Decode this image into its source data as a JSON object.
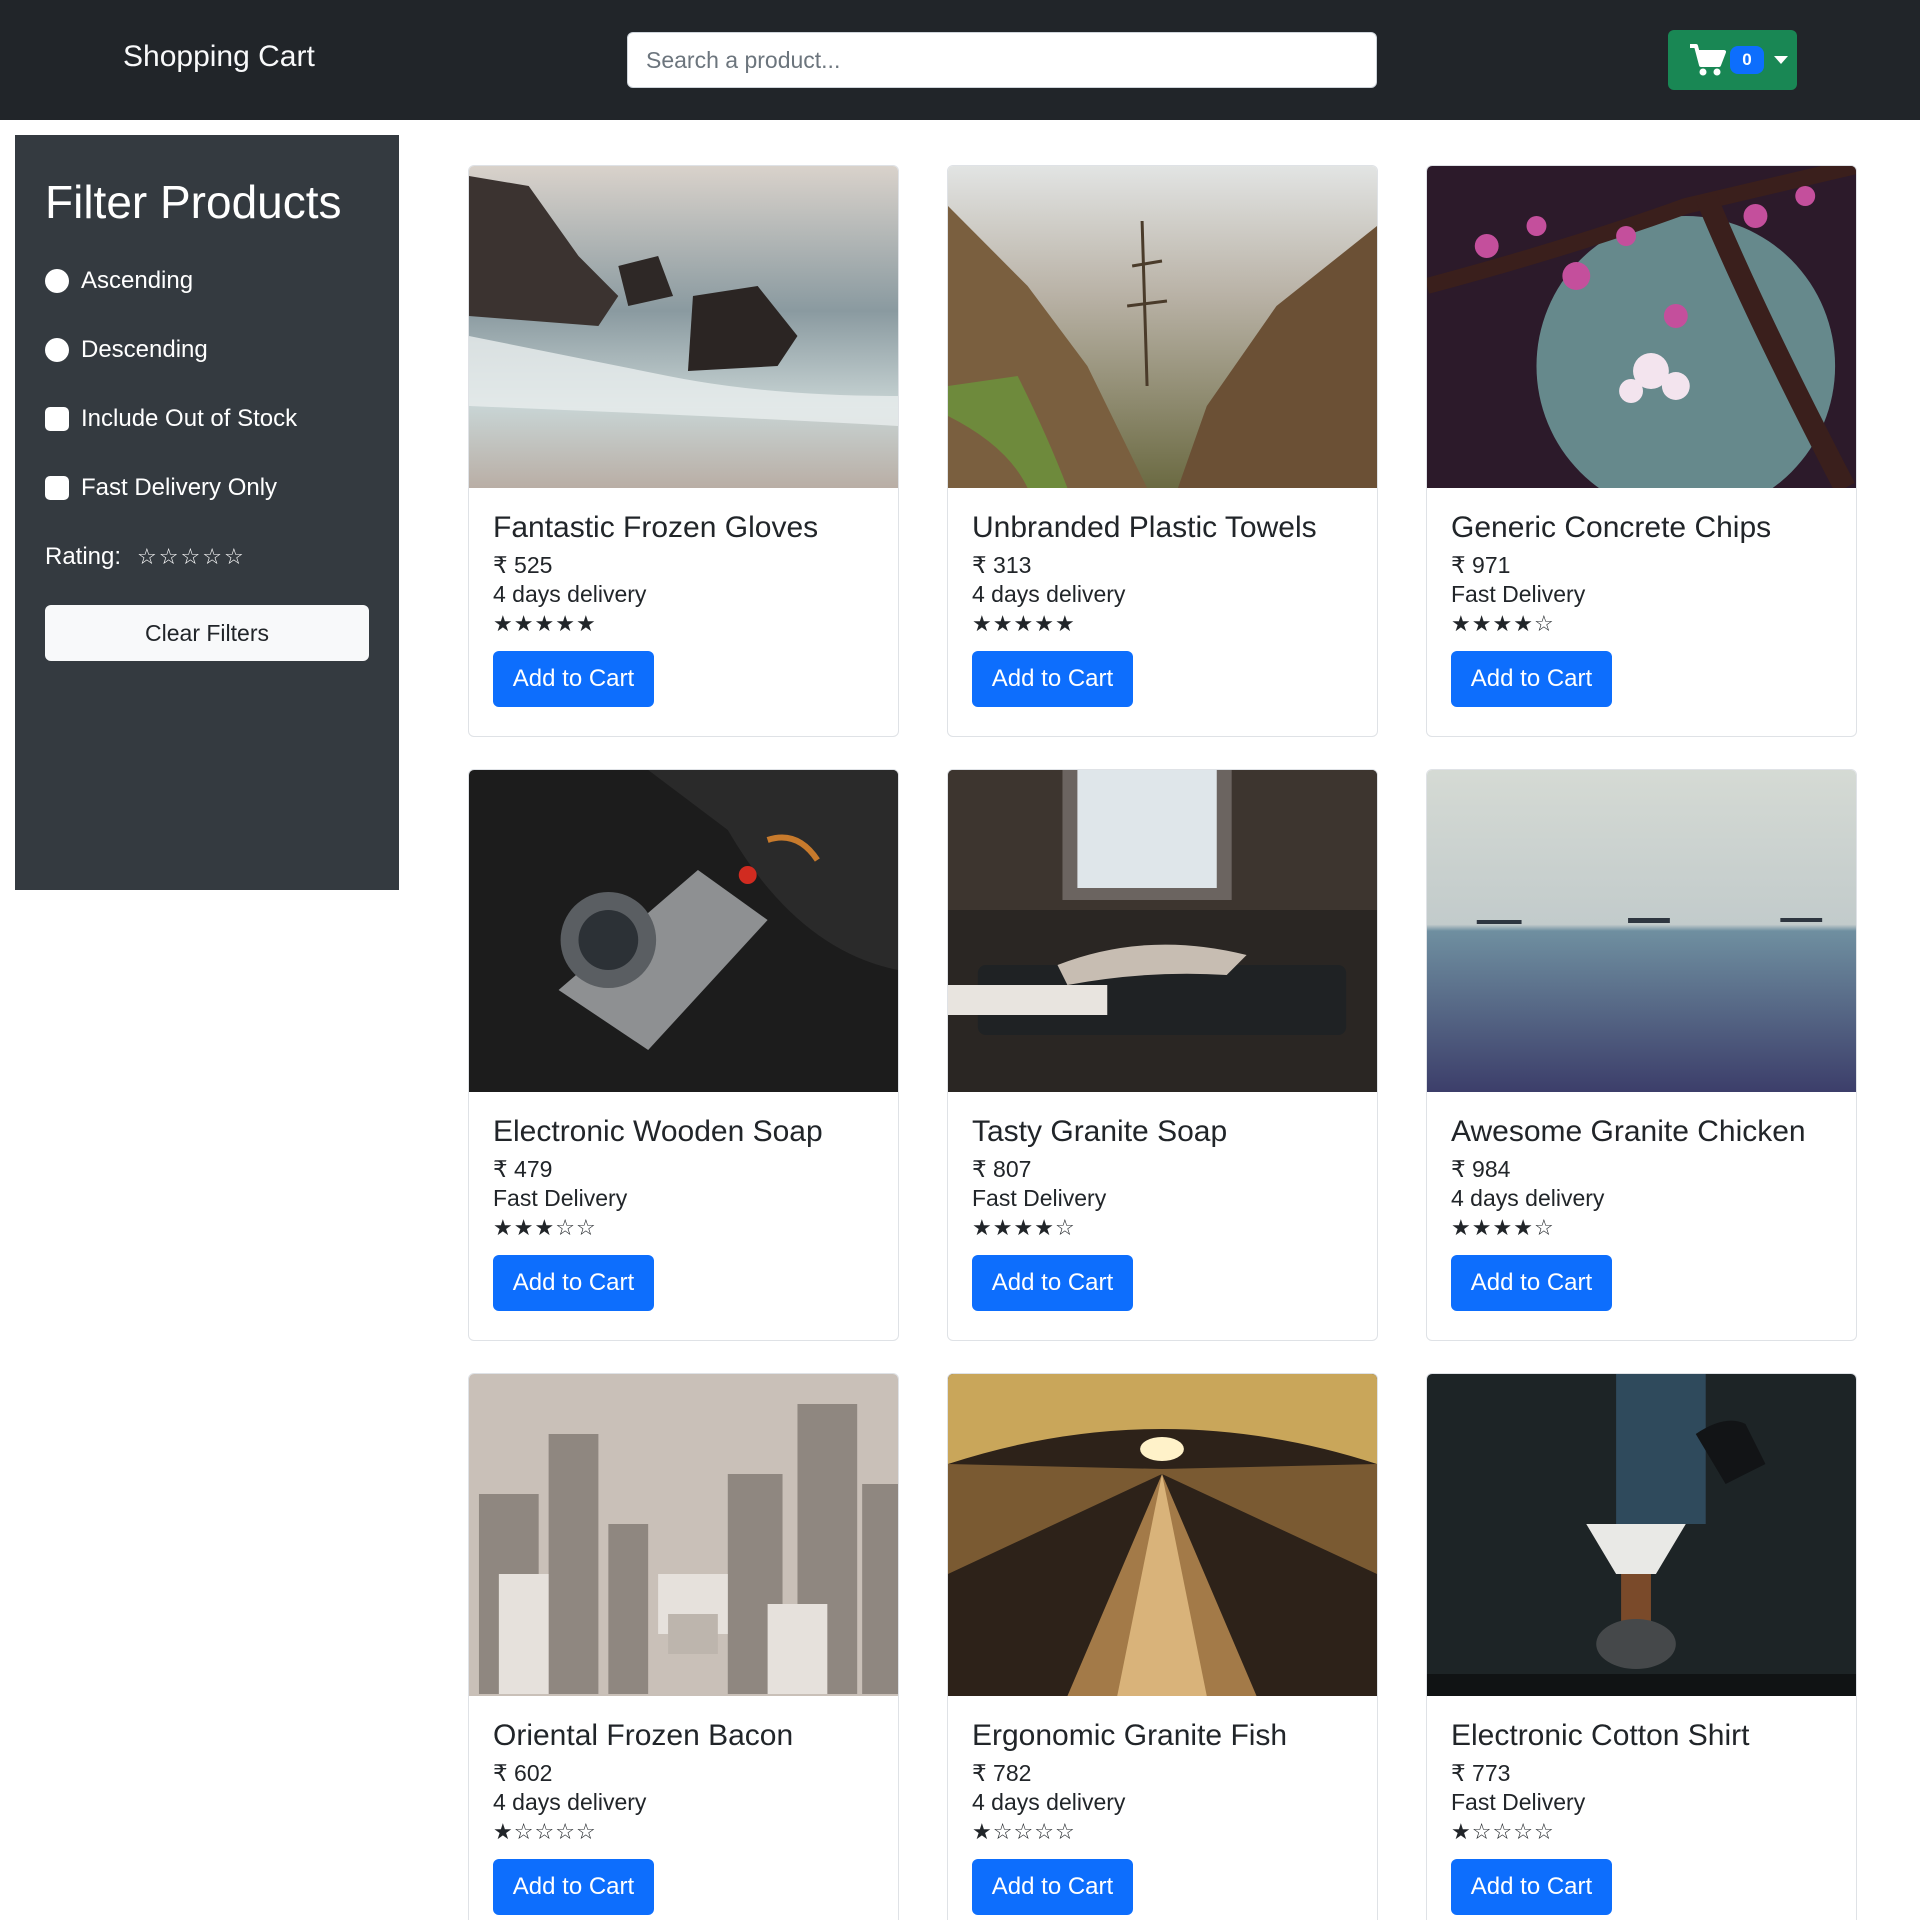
{
  "navbar": {
    "brand": "Shopping Cart",
    "search_placeholder": "Search a product...",
    "cart_count": "0",
    "cart_button_color": "#198754",
    "badge_color": "#0d6efd"
  },
  "sidebar": {
    "title": "Filter Products",
    "sort_options": [
      "Ascending",
      "Descending"
    ],
    "checkboxes": [
      "Include Out of Stock",
      "Fast Delivery Only"
    ],
    "rating_label": "Rating:",
    "rating_value": 0,
    "clear_label": "Clear Filters"
  },
  "currency_symbol": "₹",
  "products": [
    {
      "name": "Fantastic Frozen Gloves",
      "price": "525",
      "delivery": "4 days delivery",
      "rating": 5,
      "image": "sea-rocks-photo",
      "button": "Add to Cart"
    },
    {
      "name": "Unbranded Plastic Towels",
      "price": "313",
      "delivery": "4 days delivery",
      "rating": 5,
      "image": "mountain-forest-photo",
      "button": "Add to Cart"
    },
    {
      "name": "Generic Concrete Chips",
      "price": "971",
      "delivery": "Fast Delivery",
      "rating": 4,
      "image": "blossom-branch-photo",
      "button": "Add to Cart"
    },
    {
      "name": "Electronic Wooden Soap",
      "price": "479",
      "delivery": "Fast Delivery",
      "rating": 3,
      "image": "camera-photo",
      "button": "Add to Cart"
    },
    {
      "name": "Tasty Granite Soap",
      "price": "807",
      "delivery": "Fast Delivery",
      "rating": 4,
      "image": "sleeping-woman-photo",
      "button": "Add to Cart"
    },
    {
      "name": "Awesome Granite Chicken",
      "price": "984",
      "delivery": "4 days delivery",
      "rating": 4,
      "image": "ocean-ships-photo",
      "button": "Add to Cart"
    },
    {
      "name": "Oriental Frozen Bacon",
      "price": "602",
      "delivery": "4 days delivery",
      "rating": 1,
      "image": "city-aerial-photo",
      "button": "Add to Cart"
    },
    {
      "name": "Ergonomic Granite Fish",
      "price": "782",
      "delivery": "4 days delivery",
      "rating": 1,
      "image": "escalator-tunnel-photo",
      "button": "Add to Cart"
    },
    {
      "name": "Electronic Cotton Shirt",
      "price": "773",
      "delivery": "Fast Delivery",
      "rating": 1,
      "image": "coffee-pour-photo",
      "button": "Add to Cart"
    }
  ]
}
